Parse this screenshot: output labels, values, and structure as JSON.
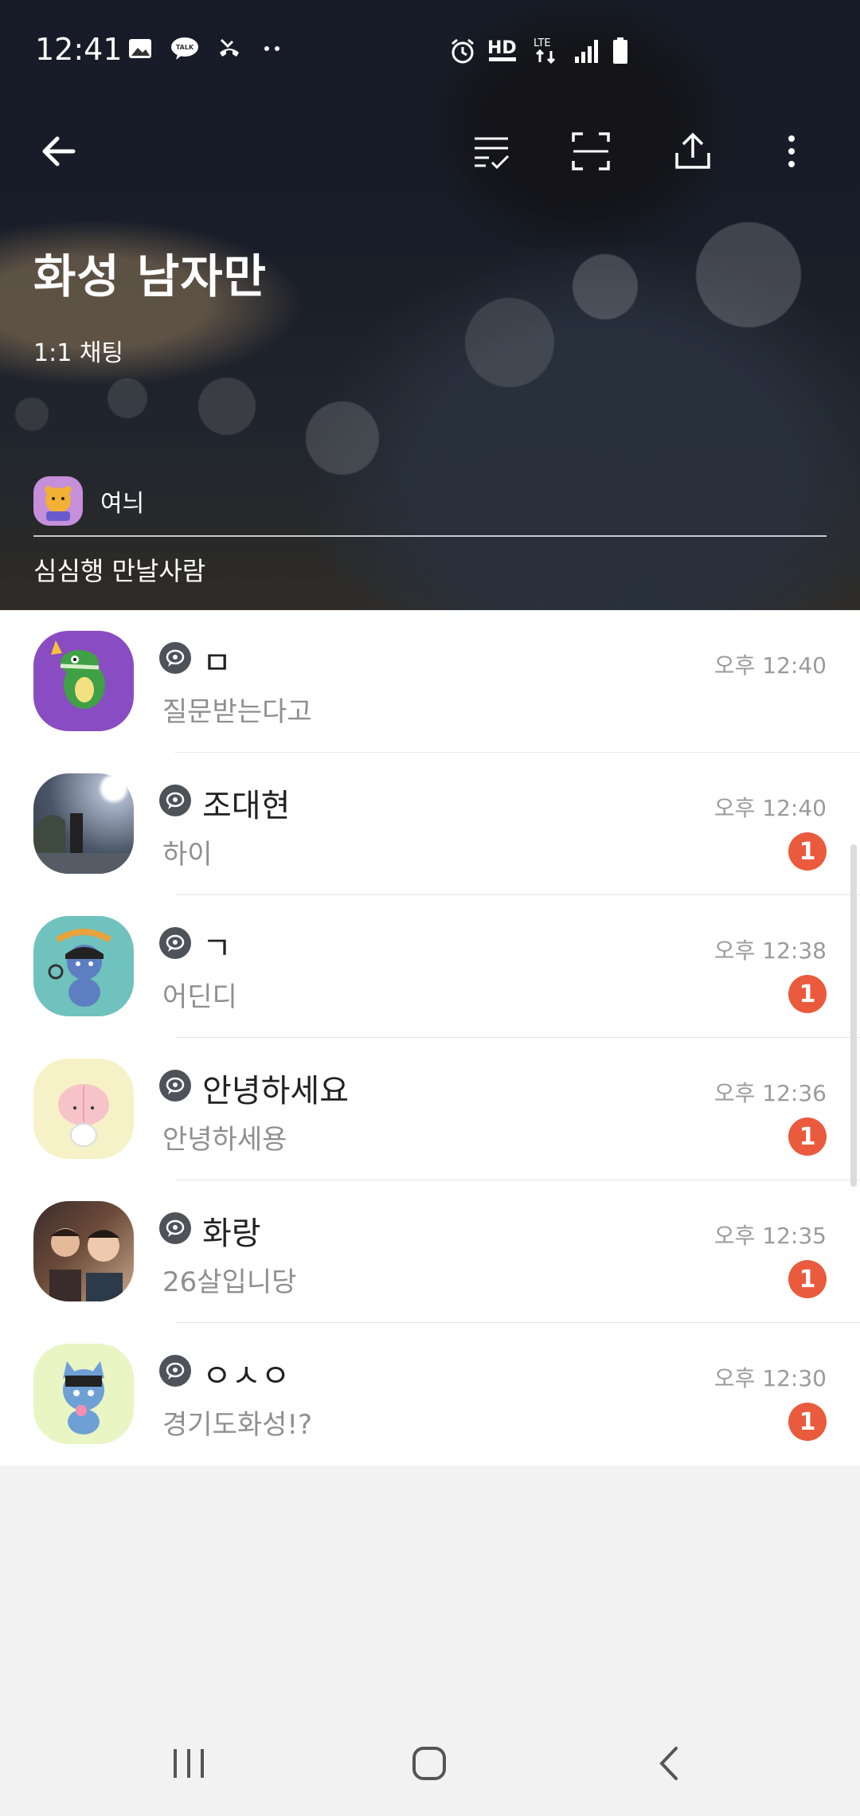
{
  "status_bar": {
    "time": "12:41",
    "left_icons": [
      "gallery-icon",
      "talk-icon",
      "missed-call-icon",
      "more-dots-icon"
    ],
    "right_icons": [
      "alarm-icon",
      "hd-voice-icon",
      "lte-icon",
      "signal-icon",
      "battery-icon"
    ],
    "talk_text": "TALK",
    "hd_text": "HD",
    "lte_text": "LTE"
  },
  "app_bar": {
    "icons": [
      "back-arrow-icon",
      "checklist-icon",
      "capture-icon",
      "share-icon",
      "more-vert-icon"
    ]
  },
  "room": {
    "title": "화성 남자만",
    "subtitle": "1:1 채팅",
    "owner_name": "여늬",
    "description": "심심행 만날사람"
  },
  "chats": [
    {
      "name": "ㅁ",
      "time": "오후 12:40",
      "message": "질문받는다고",
      "unread": ""
    },
    {
      "name": "조대현",
      "time": "오후 12:40",
      "message": "하이",
      "unread": "1"
    },
    {
      "name": "ㄱ",
      "time": "오후 12:38",
      "message": "어딘디",
      "unread": "1"
    },
    {
      "name": "안녕하세요",
      "time": "오후 12:36",
      "message": "안녕하세용",
      "unread": "1"
    },
    {
      "name": "화랑",
      "time": "오후 12:35",
      "message": "26살입니당",
      "unread": "1"
    },
    {
      "name": "ㅇㅅㅇ",
      "time": "오후 12:30",
      "message": " 경기도화성!?",
      "unread": "1"
    }
  ],
  "colors": {
    "unread_badge": "#ea5a3d",
    "chat_badge": "#4d5359",
    "time_text": "#9b9b9b",
    "message_text": "#8f8f8f"
  },
  "nav_bar": {
    "icons": [
      "recents-icon",
      "home-icon",
      "nav-back-icon"
    ]
  }
}
